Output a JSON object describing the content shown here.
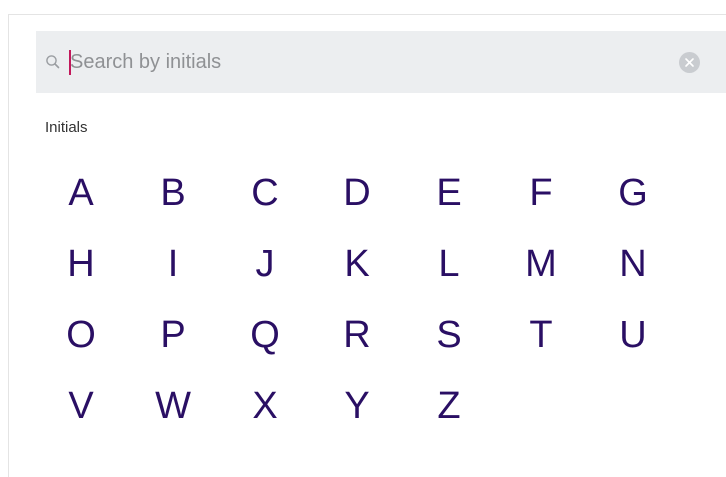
{
  "search": {
    "placeholder": "Search by initials",
    "value": ""
  },
  "initials_section": {
    "label": "Initials",
    "letters": [
      "A",
      "B",
      "C",
      "D",
      "E",
      "F",
      "G",
      "H",
      "I",
      "J",
      "K",
      "L",
      "M",
      "N",
      "O",
      "P",
      "Q",
      "R",
      "S",
      "T",
      "U",
      "V",
      "W",
      "X",
      "Y",
      "Z"
    ]
  },
  "icons": {
    "search": "search-icon",
    "clear": "clear-circle-icon"
  },
  "colors": {
    "letter": "#2a0f64",
    "caret": "#c2185b",
    "search_bg": "#eceef0"
  }
}
